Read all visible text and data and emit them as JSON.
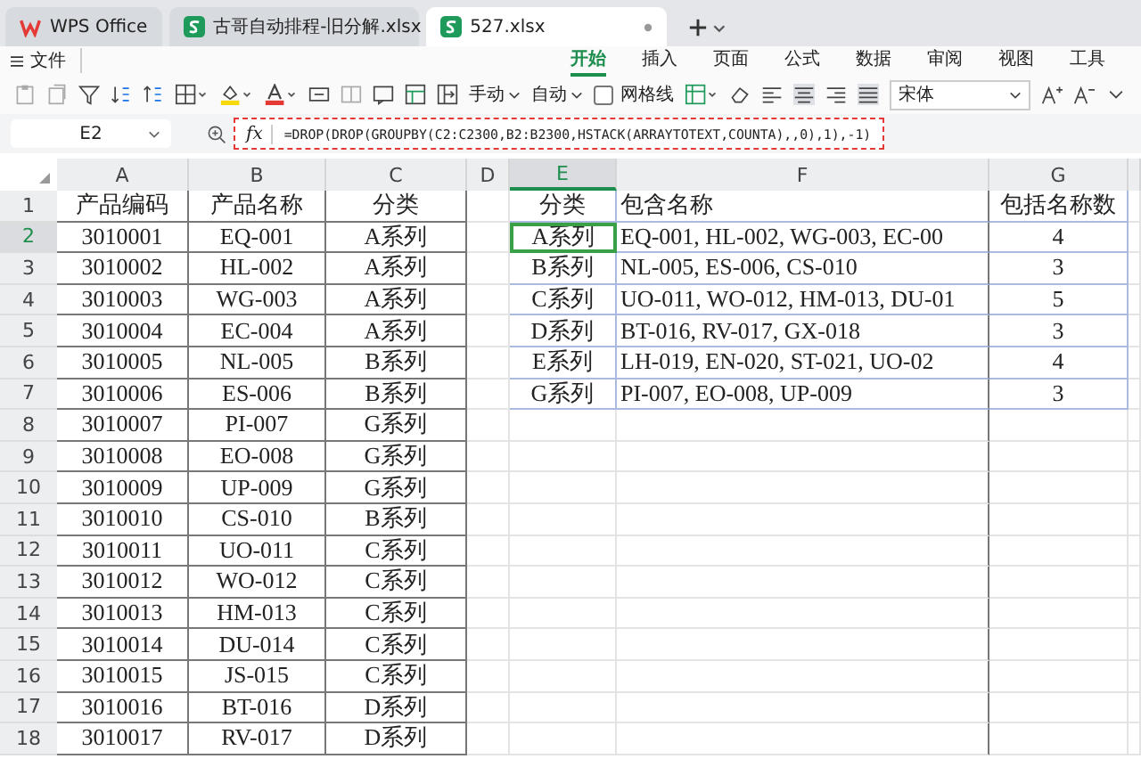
{
  "tabs": [
    {
      "label": "WPS Office",
      "kind": "app",
      "selected": false
    },
    {
      "label": "古哥自动排程-旧分解.xlsx",
      "kind": "file",
      "selected": false
    },
    {
      "label": "527.xlsx",
      "kind": "file",
      "selected": true
    }
  ],
  "menu": {
    "file_label": "文件",
    "ribbon_tabs": [
      {
        "label": "开始",
        "selected": true
      },
      {
        "label": "插入",
        "selected": false
      },
      {
        "label": "页面",
        "selected": false
      },
      {
        "label": "公式",
        "selected": false
      },
      {
        "label": "数据",
        "selected": false
      },
      {
        "label": "审阅",
        "selected": false
      },
      {
        "label": "视图",
        "selected": false
      },
      {
        "label": "工具",
        "selected": false
      }
    ]
  },
  "toolbar": {
    "row_height_dropdown": "手动",
    "col_width_dropdown": "自动",
    "gridlines": {
      "label": "网格线",
      "checked": false
    },
    "font": "宋体"
  },
  "formula_bar": {
    "name_box": "E2",
    "fx_label": "fx",
    "formula": "=DROP(DROP(GROUPBY(C2:C2300,B2:B2300,HSTACK(ARRAYTOTEXT,COUNTA),,0),1),-1)"
  },
  "sheet": {
    "columns": [
      {
        "label": "A",
        "selected": false
      },
      {
        "label": "B",
        "selected": false
      },
      {
        "label": "C",
        "selected": false
      },
      {
        "label": "D",
        "selected": false
      },
      {
        "label": "E",
        "selected": true
      },
      {
        "label": "F",
        "selected": false
      },
      {
        "label": "G",
        "selected": false
      }
    ],
    "rows": [
      {
        "number": "1",
        "selected": false,
        "cells": {
          "A": "产品编码",
          "B": "产品名称",
          "C": "分类",
          "E": "分类",
          "F": "包含名称",
          "G": "包括名称数"
        }
      },
      {
        "number": "2",
        "selected": true,
        "cells": {
          "A": "3010001",
          "B": "EQ-001",
          "C": "A系列",
          "E": "A系列",
          "F": "EQ-001, HL-002, WG-003, EC-00",
          "G": "4"
        }
      },
      {
        "number": "3",
        "selected": false,
        "cells": {
          "A": "3010002",
          "B": "HL-002",
          "C": "A系列",
          "E": "B系列",
          "F": "NL-005, ES-006, CS-010",
          "G": "3"
        }
      },
      {
        "number": "4",
        "selected": false,
        "cells": {
          "A": "3010003",
          "B": "WG-003",
          "C": "A系列",
          "E": "C系列",
          "F": "UO-011, WO-012, HM-013, DU-01",
          "G": "5"
        }
      },
      {
        "number": "5",
        "selected": false,
        "cells": {
          "A": "3010004",
          "B": "EC-004",
          "C": "A系列",
          "E": "D系列",
          "F": "BT-016, RV-017, GX-018",
          "G": "3"
        }
      },
      {
        "number": "6",
        "selected": false,
        "cells": {
          "A": "3010005",
          "B": "NL-005",
          "C": "B系列",
          "E": "E系列",
          "F": "LH-019, EN-020, ST-021, UO-02",
          "G": "4"
        }
      },
      {
        "number": "7",
        "selected": false,
        "cells": {
          "A": "3010006",
          "B": "ES-006",
          "C": "B系列",
          "E": "G系列",
          "F": "PI-007, EO-008, UP-009",
          "G": "3"
        }
      },
      {
        "number": "8",
        "selected": false,
        "cells": {
          "A": "3010007",
          "B": "PI-007",
          "C": "G系列"
        }
      },
      {
        "number": "9",
        "selected": false,
        "cells": {
          "A": "3010008",
          "B": "EO-008",
          "C": "G系列"
        }
      },
      {
        "number": "10",
        "selected": false,
        "cells": {
          "A": "3010009",
          "B": "UP-009",
          "C": "G系列"
        }
      },
      {
        "number": "11",
        "selected": false,
        "cells": {
          "A": "3010010",
          "B": "CS-010",
          "C": "B系列"
        }
      },
      {
        "number": "12",
        "selected": false,
        "cells": {
          "A": "3010011",
          "B": "UO-011",
          "C": "C系列"
        }
      },
      {
        "number": "13",
        "selected": false,
        "cells": {
          "A": "3010012",
          "B": "WO-012",
          "C": "C系列"
        }
      },
      {
        "number": "14",
        "selected": false,
        "cells": {
          "A": "3010013",
          "B": "HM-013",
          "C": "C系列"
        }
      },
      {
        "number": "15",
        "selected": false,
        "cells": {
          "A": "3010014",
          "B": "DU-014",
          "C": "C系列"
        }
      },
      {
        "number": "16",
        "selected": false,
        "cells": {
          "A": "3010015",
          "B": "JS-015",
          "C": "C系列"
        }
      },
      {
        "number": "17",
        "selected": false,
        "cells": {
          "A": "3010016",
          "B": "BT-016",
          "C": "D系列"
        }
      },
      {
        "number": "18",
        "selected": false,
        "cells": {
          "A": "3010017",
          "B": "RV-017",
          "C": "D系列"
        }
      }
    ]
  }
}
